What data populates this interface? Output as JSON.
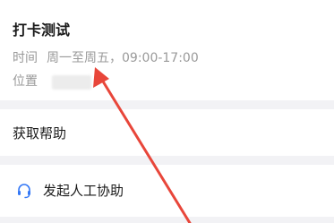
{
  "checkin": {
    "title": "打卡测试",
    "time_label": "时间",
    "time_value": "周一至周五，09:00-17:00",
    "location_label": "位置"
  },
  "help": {
    "label": "获取帮助"
  },
  "assist": {
    "icon": "headset-icon",
    "label": "发起人工协助"
  },
  "colors": {
    "background": "#f2f2f5",
    "card": "#ffffff",
    "annotation_arrow": "#e8463a"
  }
}
